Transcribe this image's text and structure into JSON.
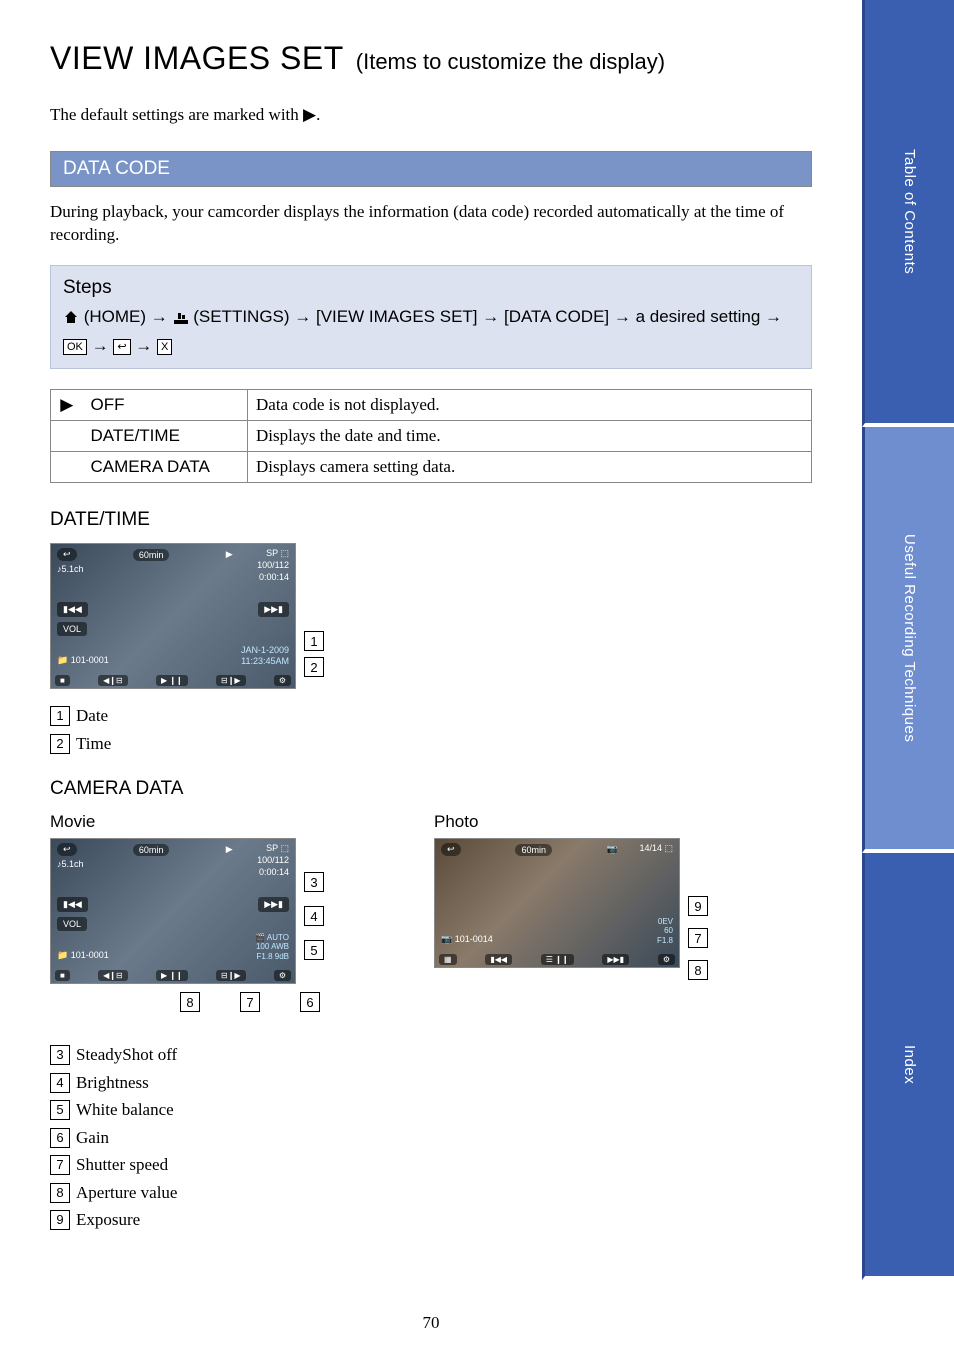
{
  "title": {
    "main": "VIEW IMAGES SET",
    "sub": "(Items to customize the display)"
  },
  "intro_text": "The default settings are marked with ▶.",
  "section": {
    "heading": "DATA CODE",
    "description": "During playback, your camcorder displays the information (data code) recorded automatically at the time of recording."
  },
  "steps": {
    "label": "Steps",
    "line": "(HOME) → (SETTINGS) → [VIEW IMAGES SET] → [DATA CODE] → a desired setting →",
    "keys": [
      "OK",
      "↩",
      "X"
    ]
  },
  "options": [
    {
      "default": true,
      "name": "OFF",
      "desc": "Data code is not displayed."
    },
    {
      "default": false,
      "name": "DATE/TIME",
      "desc": "Displays the date and time."
    },
    {
      "default": false,
      "name": "CAMERA DATA",
      "desc": "Displays camera setting data."
    }
  ],
  "date_time": {
    "heading": "DATE/TIME",
    "callouts": [
      "1",
      "2"
    ],
    "legend": [
      {
        "n": "1",
        "label": "Date"
      },
      {
        "n": "2",
        "label": "Time"
      }
    ],
    "screen": {
      "battery": "60min",
      "audio": "♪5.1ch",
      "sp": "SP",
      "count": "100/112",
      "elapsed": "0:00:14",
      "folder": "101-0001",
      "date": "JAN-1-2009",
      "time": "11:23:45AM",
      "vol": "VOL"
    }
  },
  "camera_data": {
    "heading": "CAMERA DATA",
    "movie": {
      "label": "Movie",
      "side_callouts": [
        "3",
        "4",
        "5"
      ],
      "below_callouts": [
        "8",
        "7",
        "6"
      ],
      "screen": {
        "battery": "60min",
        "audio": "♪5.1ch",
        "sp": "SP",
        "count": "100/112",
        "elapsed": "0:00:14",
        "folder": "101-0001",
        "overlay_lines": [
          "AUTO",
          "100  AWB",
          "F1.8  9dB"
        ],
        "vol": "VOL"
      }
    },
    "photo": {
      "label": "Photo",
      "side_callouts": [
        "9",
        "7",
        "8"
      ],
      "screen": {
        "battery": "60min",
        "count": "14/14",
        "folder": "101-0014",
        "overlay_lines": [
          "0EV",
          "60",
          "F1.8"
        ]
      }
    },
    "legend": [
      {
        "n": "3",
        "label": "SteadyShot off"
      },
      {
        "n": "4",
        "label": "Brightness"
      },
      {
        "n": "5",
        "label": "White balance"
      },
      {
        "n": "6",
        "label": "Gain"
      },
      {
        "n": "7",
        "label": "Shutter speed"
      },
      {
        "n": "8",
        "label": "Aperture value"
      },
      {
        "n": "9",
        "label": "Exposure"
      }
    ]
  },
  "side_tabs": [
    "Table of Contents",
    "Useful Recording Techniques",
    "Index"
  ],
  "page_number": "70"
}
